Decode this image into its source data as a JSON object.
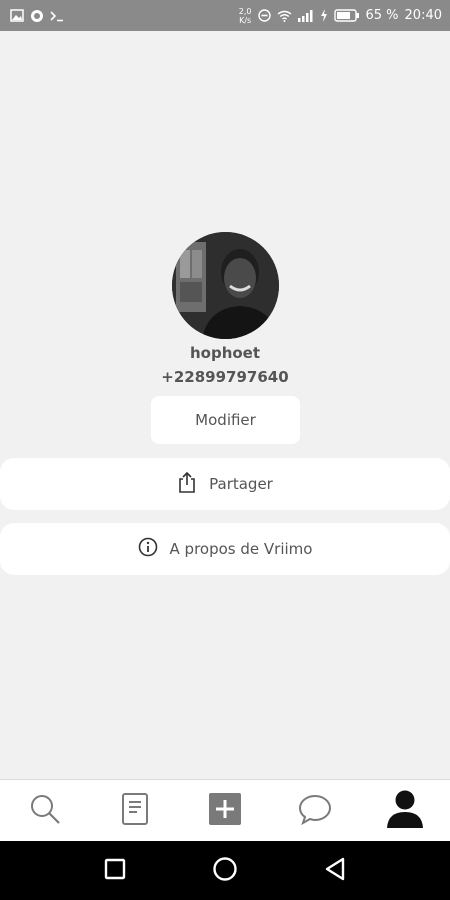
{
  "status_bar": {
    "speed_value": "2,0",
    "speed_unit": "K/s",
    "battery_percent": "65 %",
    "time": "20:40",
    "icons": [
      "image-icon",
      "circle-app-icon",
      "terminal-icon",
      "do-not-disturb-icon",
      "wifi-icon",
      "signal-icon",
      "charging-icon",
      "battery-icon"
    ]
  },
  "profile": {
    "username": "hophoet",
    "phone": "+22899797640",
    "modify_label": "Modifier"
  },
  "menu": {
    "share_label": "Partager",
    "about_label": "A propos de Vriimo"
  },
  "bottom_nav": {
    "items": [
      "search-icon",
      "document-icon",
      "add-icon",
      "chat-icon",
      "profile-icon"
    ],
    "active": "profile-icon"
  },
  "system_nav": {
    "items": [
      "recents-icon",
      "home-icon",
      "back-icon"
    ]
  },
  "colors": {
    "status_bar": "#8a8a8a",
    "background": "#f1f1f1",
    "card": "#ffffff",
    "text": "#555555",
    "active_icon": "#111111"
  }
}
